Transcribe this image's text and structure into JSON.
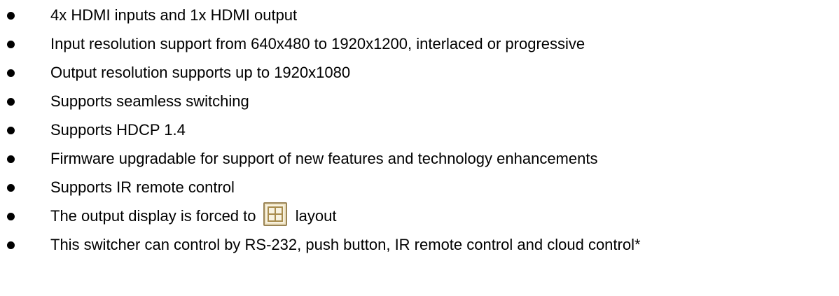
{
  "features": [
    "4x HDMI inputs and 1x HDMI output",
    "Input resolution support from 640x480 to 1920x1200, interlaced or progressive",
    "Output resolution supports up to 1920x1080",
    "Supports seamless switching",
    "Supports HDCP 1.4",
    "Firmware upgradable for support of new features and technology enhancements",
    "Supports IR remote control"
  ],
  "layout_item": {
    "before": "The output display is forced to",
    "icon": "quad-layout-icon",
    "after": "layout"
  },
  "last_feature": "This switcher can control by RS-232, push button, IR remote control and cloud control*",
  "colors": {
    "text": "#000000",
    "icon_border": "#9a8455",
    "icon_fill": "#f8f2e1"
  }
}
